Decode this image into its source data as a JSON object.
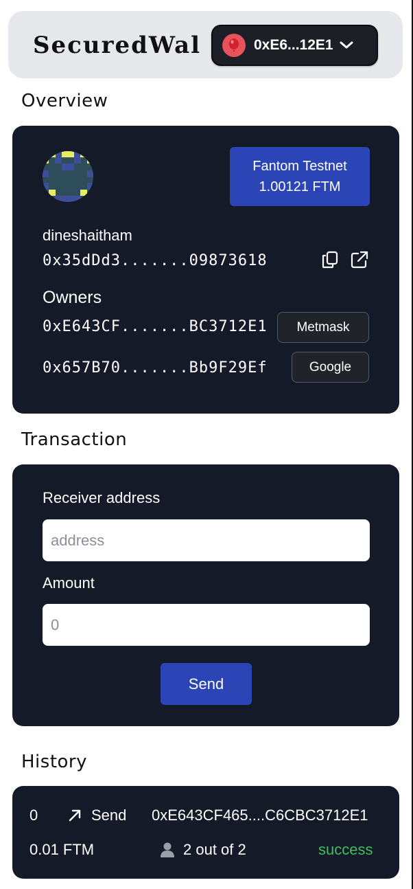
{
  "header": {
    "brand": "SecuredWal",
    "account_label": "0xE6...12E1"
  },
  "overview": {
    "title": "Overview",
    "network_name": "Fantom Testnet",
    "balance": "1.00121 FTM",
    "username": "dineshaitham",
    "wallet_address": "0x35dDd3.......09873618",
    "owners_label": "Owners",
    "owners": [
      {
        "address": "0xE643CF.......BC3712E1",
        "provider": "Metmask"
      },
      {
        "address": "0x657B70.......Bb9F29Ef",
        "provider": "Google"
      }
    ]
  },
  "transaction": {
    "title": "Transaction",
    "receiver_label": "Receiver address",
    "receiver_placeholder": "address",
    "amount_label": "Amount",
    "amount_placeholder": "0",
    "send_label": "Send"
  },
  "history": {
    "title": "History",
    "items": [
      {
        "index": "0",
        "type": "Send",
        "to": "0xE643CF465....C6CBC3712E1",
        "amount": "0.01 FTM",
        "confirmations": "2 out of 2",
        "status": "success"
      }
    ]
  },
  "colors": {
    "card_bg": "#151a28",
    "accent": "#2b45b7",
    "success": "#3fbf5f",
    "header_bg": "#e7e8ec"
  },
  "icons": [
    "balloon-icon",
    "chevron-down-icon",
    "copy-icon",
    "external-link-icon",
    "arrow-up-right-icon",
    "user-icon",
    "identicon"
  ]
}
